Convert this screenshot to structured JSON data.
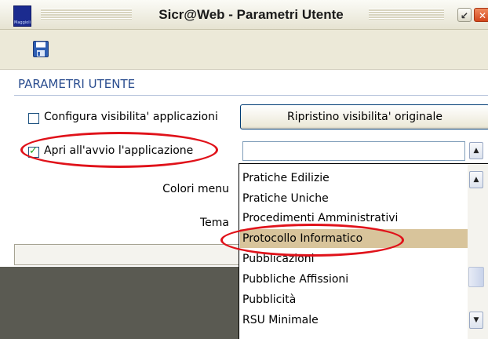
{
  "window": {
    "title": "Sicr@Web - Parametri Utente",
    "logo_text": "Maggioli",
    "restore_glyph": "↙",
    "close_glyph": "✕"
  },
  "toolbar": {
    "save_icon": "save-icon"
  },
  "section": {
    "title": "PARAMETRI UTENTE"
  },
  "options": {
    "visibility_label": "Configura visibilita' applicazioni",
    "visibility_checked": false,
    "restore_button": "Ripristino visibilita' originale",
    "startup_label": "Apri all'avvio l'applicazione",
    "startup_checked": true,
    "startup_value": ""
  },
  "labels": {
    "menu_colors": "Colori menu",
    "theme": "Tema"
  },
  "dropdown": {
    "items": [
      "Pratiche Edilizie",
      "Pratiche Uniche",
      "Procedimenti Amministrativi",
      "Protocollo Informatico",
      "Pubblicazioni",
      "Pubbliche Affissioni",
      "Pubblicità",
      "RSU Minimale"
    ],
    "selected": "Protocollo Informatico",
    "selected_color": "#d8c49b"
  },
  "annotation_color": "#e0121a",
  "accent_color": "#2a4d8f"
}
